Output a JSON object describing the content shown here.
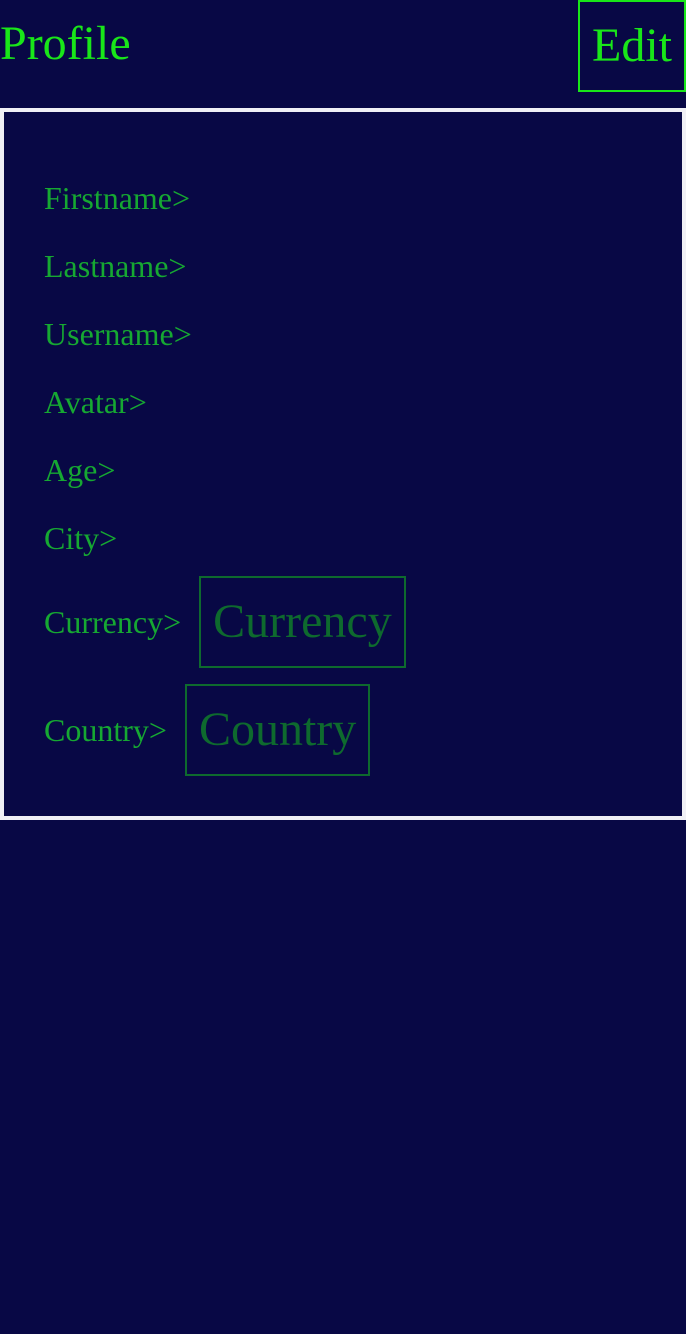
{
  "header": {
    "title": "Profile",
    "edit_label": "Edit"
  },
  "profile": {
    "fields": [
      {
        "label": "Firstname>"
      },
      {
        "label": "Lastname>"
      },
      {
        "label": "Username>"
      },
      {
        "label": "Avatar>"
      },
      {
        "label": "Age>"
      },
      {
        "label": "City>"
      },
      {
        "label": "Currency>",
        "select_value": "Currency"
      },
      {
        "label": "Country>",
        "select_value": "Country"
      }
    ]
  },
  "colors": {
    "background": "#080845",
    "accent": "#19e619",
    "label": "#16a832",
    "muted": "#0e6a2e",
    "panel_border": "#f0f0f5"
  }
}
